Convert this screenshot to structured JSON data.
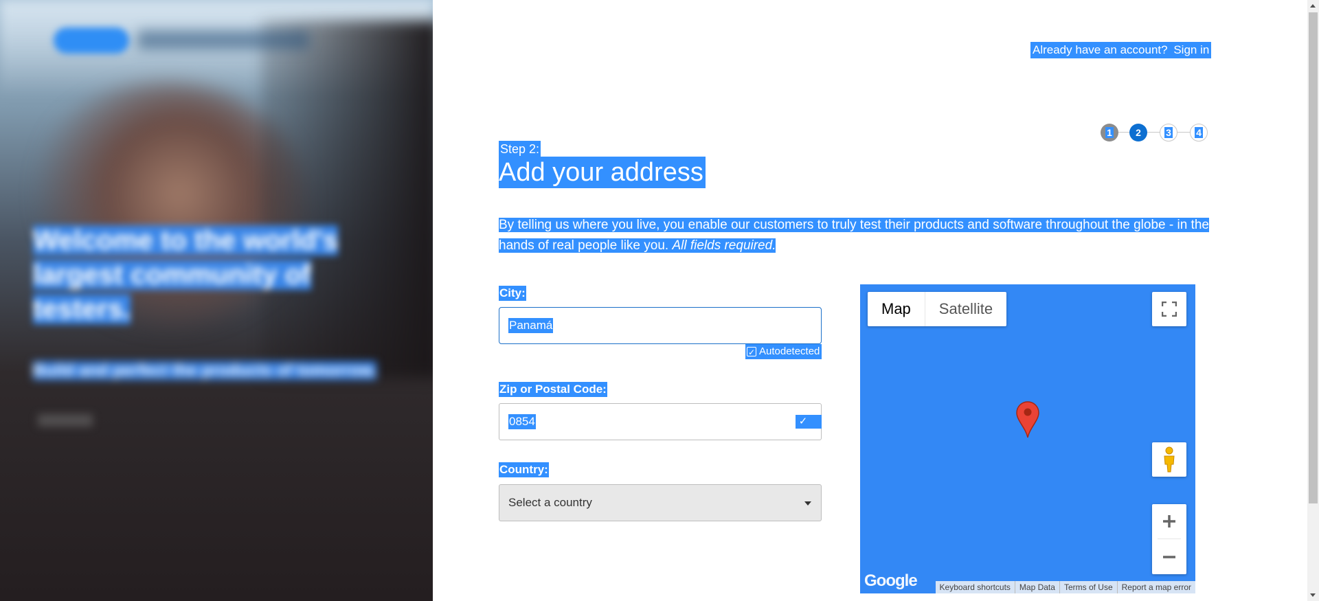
{
  "hero": {
    "headline": "Welcome to the world's largest community of testers.",
    "subline": "Build and perfect the products of tomorrow."
  },
  "header": {
    "account_prompt": "Already have an account?",
    "sign_in_label": "Sign in"
  },
  "stepper": {
    "steps": [
      "1",
      "2",
      "3",
      "4"
    ],
    "current": 2
  },
  "heading": {
    "step_label": "Step 2:",
    "title": "Add your address",
    "intro": "By telling us where you live, you enable our customers to truly test their products and software throughout the globe - in the hands of real people like you.",
    "intro_emphasis": "All fields required."
  },
  "form": {
    "city": {
      "label": "City:",
      "value": "Panamá",
      "autodetected_label": "Autodetected"
    },
    "zip": {
      "label": "Zip or Postal Code:",
      "value": "0854"
    },
    "country": {
      "label": "Country:",
      "value": "Select a country"
    }
  },
  "map": {
    "type_options": [
      "Map",
      "Satellite"
    ],
    "selected_type": "Map",
    "logo_text": "Google",
    "footer_links": [
      "Keyboard shortcuts",
      "Map Data",
      "Terms of Use",
      "Report a map error"
    ],
    "colors": {
      "background": "#3388f5",
      "pin": "#ea4335"
    }
  },
  "colors": {
    "selection": "#3390ff",
    "primary": "#0d6fd1"
  }
}
